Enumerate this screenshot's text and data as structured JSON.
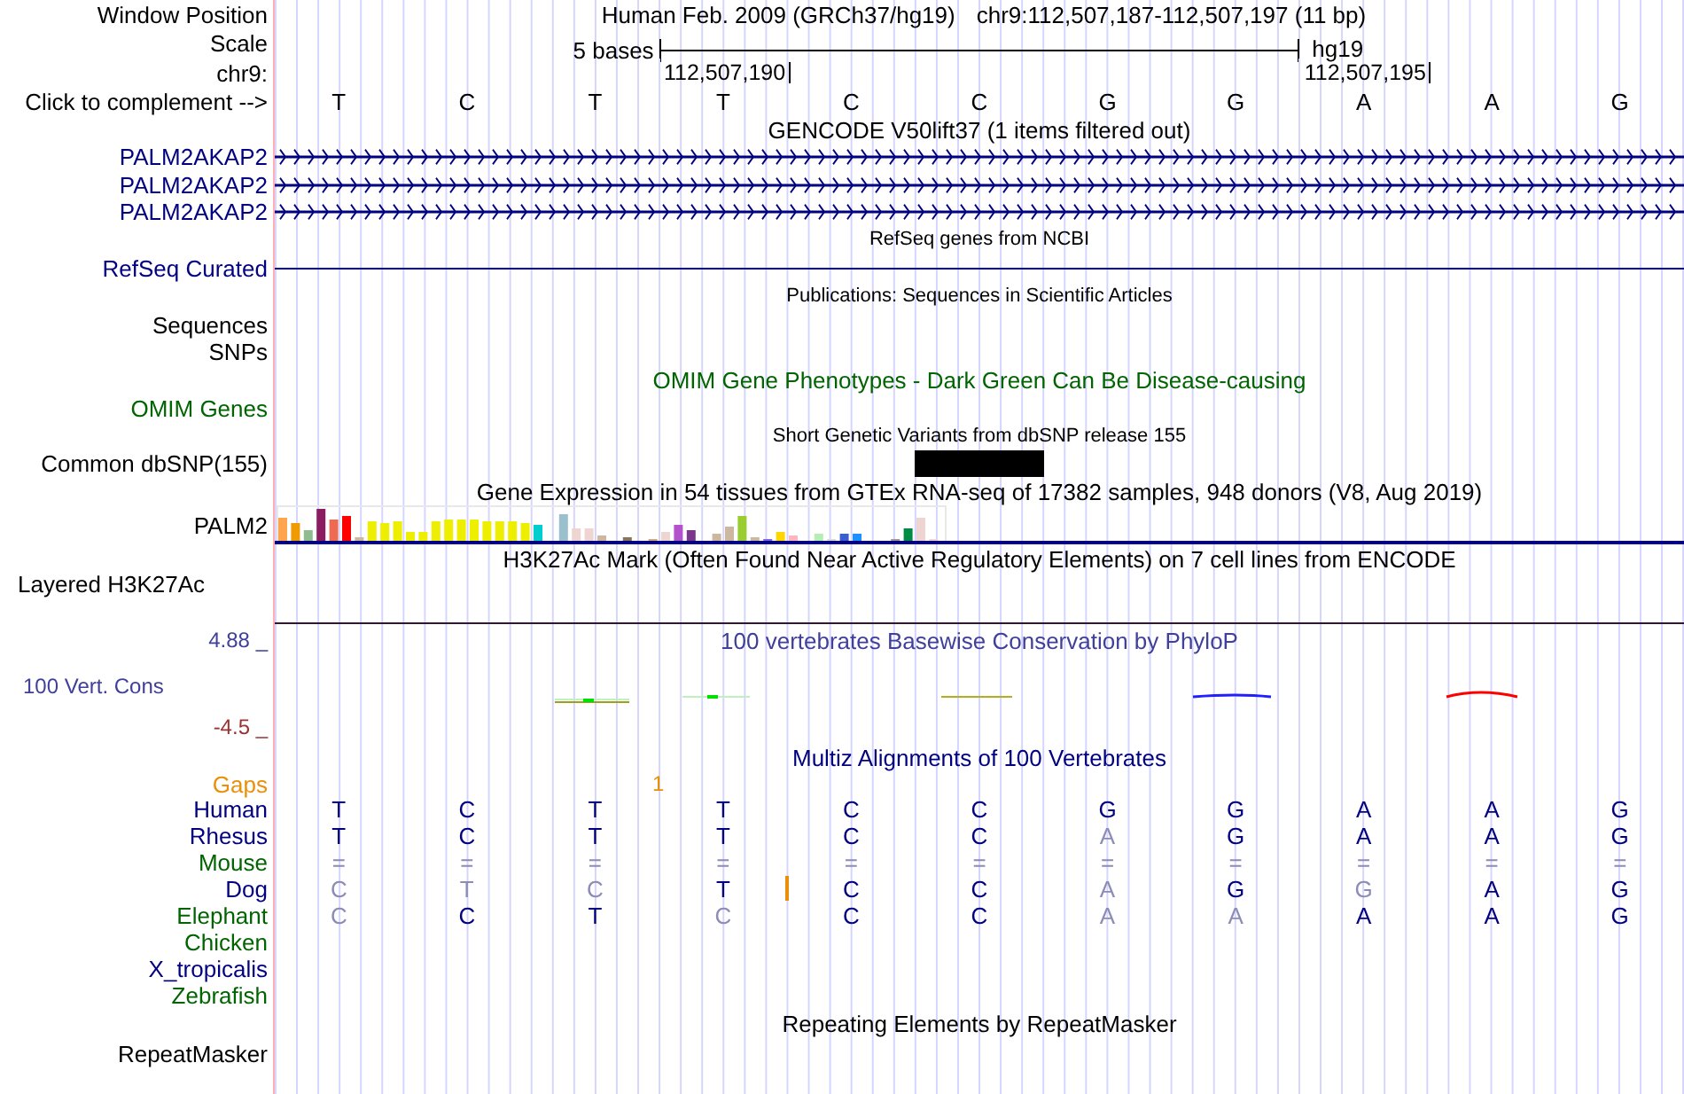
{
  "position": {
    "label": "Window Position",
    "assembly": "Human Feb. 2009 (GRCh37/hg19)",
    "range": "chr9:112,507,187-112,507,197 (11 bp)"
  },
  "scale": {
    "label": "Scale",
    "span": "5 bases",
    "build": "hg19"
  },
  "coordinates": {
    "label": "chr9:",
    "ticks": [
      "112,507,190",
      "112,507,195"
    ]
  },
  "sequence": {
    "label": "Click to complement -->",
    "bases": [
      "T",
      "C",
      "T",
      "T",
      "C",
      "C",
      "G",
      "G",
      "A",
      "A",
      "G"
    ]
  },
  "tracks": [
    {
      "kind": "title",
      "text": "GENCODE V50lift37 (1 items filtered out)",
      "color": "#000000"
    },
    {
      "kind": "gene",
      "label": "PALM2AKAP2",
      "color": "#000080"
    },
    {
      "kind": "gene",
      "label": "PALM2AKAP2",
      "color": "#000080"
    },
    {
      "kind": "gene",
      "label": "PALM2AKAP2",
      "color": "#000080"
    },
    {
      "kind": "caption",
      "text": "RefSeq genes from NCBI",
      "color": "#000000"
    },
    {
      "kind": "line",
      "label": "RefSeq Curated",
      "color": "#000080"
    },
    {
      "kind": "caption",
      "text": "Publications: Sequences in Scientific Articles",
      "color": "#000000"
    },
    {
      "kind": "label",
      "label": "Sequences",
      "color": "#000000"
    },
    {
      "kind": "label",
      "label": "SNPs",
      "color": "#000000"
    },
    {
      "kind": "title",
      "text": "OMIM Gene Phenotypes - Dark Green Can Be Disease-causing",
      "color": "#006400"
    },
    {
      "kind": "label",
      "label": "OMIM Genes",
      "color": "#006400"
    },
    {
      "kind": "caption",
      "text": "Short Genetic Variants from dbSNP release 155",
      "color": "#000000"
    },
    {
      "kind": "variant",
      "label": "Common dbSNP(155)",
      "color": "#000000"
    },
    {
      "kind": "title",
      "text": "Gene Expression in 54 tissues from GTEx RNA-seq of 17382 samples, 948 donors (V8, Aug 2019)",
      "color": "#000000"
    },
    {
      "kind": "expression",
      "label": "PALM2",
      "color": "#000000"
    },
    {
      "kind": "title",
      "text": "H3K27Ac Mark (Often Found Near Active Regulatory Elements) on 7 cell lines from ENCODE",
      "color": "#000000"
    },
    {
      "kind": "signal",
      "label": "Layered H3K27Ac",
      "color": "#000000"
    },
    {
      "kind": "conservation",
      "title": "100 vertebrates Basewise Conservation by PhyloP",
      "label": "100 Vert. Cons",
      "max": "4.88 _",
      "min": "-4.5 _",
      "color": "#40409a"
    },
    {
      "kind": "title",
      "text": "Multiz Alignments of 100 Vertebrates",
      "color": "#000080"
    },
    {
      "kind": "gaps",
      "label": "Gaps",
      "text": "1",
      "color": "#e8900a"
    },
    {
      "kind": "species",
      "label": "Human",
      "color": "#000080",
      "insertion": false,
      "bases": [
        {
          "base": "T",
          "match": true
        },
        {
          "base": "C",
          "match": true
        },
        {
          "base": "T",
          "match": true
        },
        {
          "base": "T",
          "match": true
        },
        {
          "base": "C",
          "match": true
        },
        {
          "base": "C",
          "match": true
        },
        {
          "base": "G",
          "match": true
        },
        {
          "base": "G",
          "match": true
        },
        {
          "base": "A",
          "match": true
        },
        {
          "base": "A",
          "match": true
        },
        {
          "base": "G",
          "match": true
        }
      ]
    },
    {
      "kind": "species",
      "label": "Rhesus",
      "color": "#000080",
      "insertion": false,
      "bases": [
        {
          "base": "T",
          "match": true
        },
        {
          "base": "C",
          "match": true
        },
        {
          "base": "T",
          "match": true
        },
        {
          "base": "T",
          "match": true
        },
        {
          "base": "C",
          "match": true
        },
        {
          "base": "C",
          "match": true
        },
        {
          "base": "A",
          "match": false
        },
        {
          "base": "G",
          "match": true
        },
        {
          "base": "A",
          "match": true
        },
        {
          "base": "A",
          "match": true
        },
        {
          "base": "G",
          "match": true
        }
      ]
    },
    {
      "kind": "species",
      "label": "Mouse",
      "color": "#006400",
      "insertion": false,
      "bases": [
        {
          "base": "=",
          "match": false
        },
        {
          "base": "=",
          "match": false
        },
        {
          "base": "=",
          "match": false
        },
        {
          "base": "=",
          "match": false
        },
        {
          "base": "=",
          "match": false
        },
        {
          "base": "=",
          "match": false
        },
        {
          "base": "=",
          "match": false
        },
        {
          "base": "=",
          "match": false
        },
        {
          "base": "=",
          "match": false
        },
        {
          "base": "=",
          "match": false
        },
        {
          "base": "=",
          "match": false
        }
      ]
    },
    {
      "kind": "species",
      "label": "Dog",
      "color": "#000080",
      "insertion": true,
      "bases": [
        {
          "base": "C",
          "match": false
        },
        {
          "base": "T",
          "match": false
        },
        {
          "base": "C",
          "match": false
        },
        {
          "base": "T",
          "match": true
        },
        {
          "base": "C",
          "match": true
        },
        {
          "base": "C",
          "match": true
        },
        {
          "base": "A",
          "match": false
        },
        {
          "base": "G",
          "match": true
        },
        {
          "base": "G",
          "match": false
        },
        {
          "base": "A",
          "match": true
        },
        {
          "base": "G",
          "match": true
        }
      ]
    },
    {
      "kind": "species",
      "label": "Elephant",
      "color": "#006400",
      "insertion": false,
      "bases": [
        {
          "base": "C",
          "match": false
        },
        {
          "base": "C",
          "match": true
        },
        {
          "base": "T",
          "match": true
        },
        {
          "base": "C",
          "match": false
        },
        {
          "base": "C",
          "match": true
        },
        {
          "base": "C",
          "match": true
        },
        {
          "base": "A",
          "match": false
        },
        {
          "base": "A",
          "match": false
        },
        {
          "base": "A",
          "match": true
        },
        {
          "base": "A",
          "match": true
        },
        {
          "base": "G",
          "match": true
        }
      ]
    },
    {
      "kind": "species",
      "label": "Chicken",
      "color": "#006400",
      "insertion": false
    },
    {
      "kind": "species",
      "label": "X_tropicalis",
      "color": "#000080",
      "insertion": false
    },
    {
      "kind": "species",
      "label": "Zebrafish",
      "color": "#006400",
      "insertion": false
    },
    {
      "kind": "title",
      "text": "Repeating Elements by RepeatMasker",
      "color": "#000000"
    },
    {
      "kind": "label",
      "label": "RepeatMasker",
      "color": "#000000"
    }
  ]
}
